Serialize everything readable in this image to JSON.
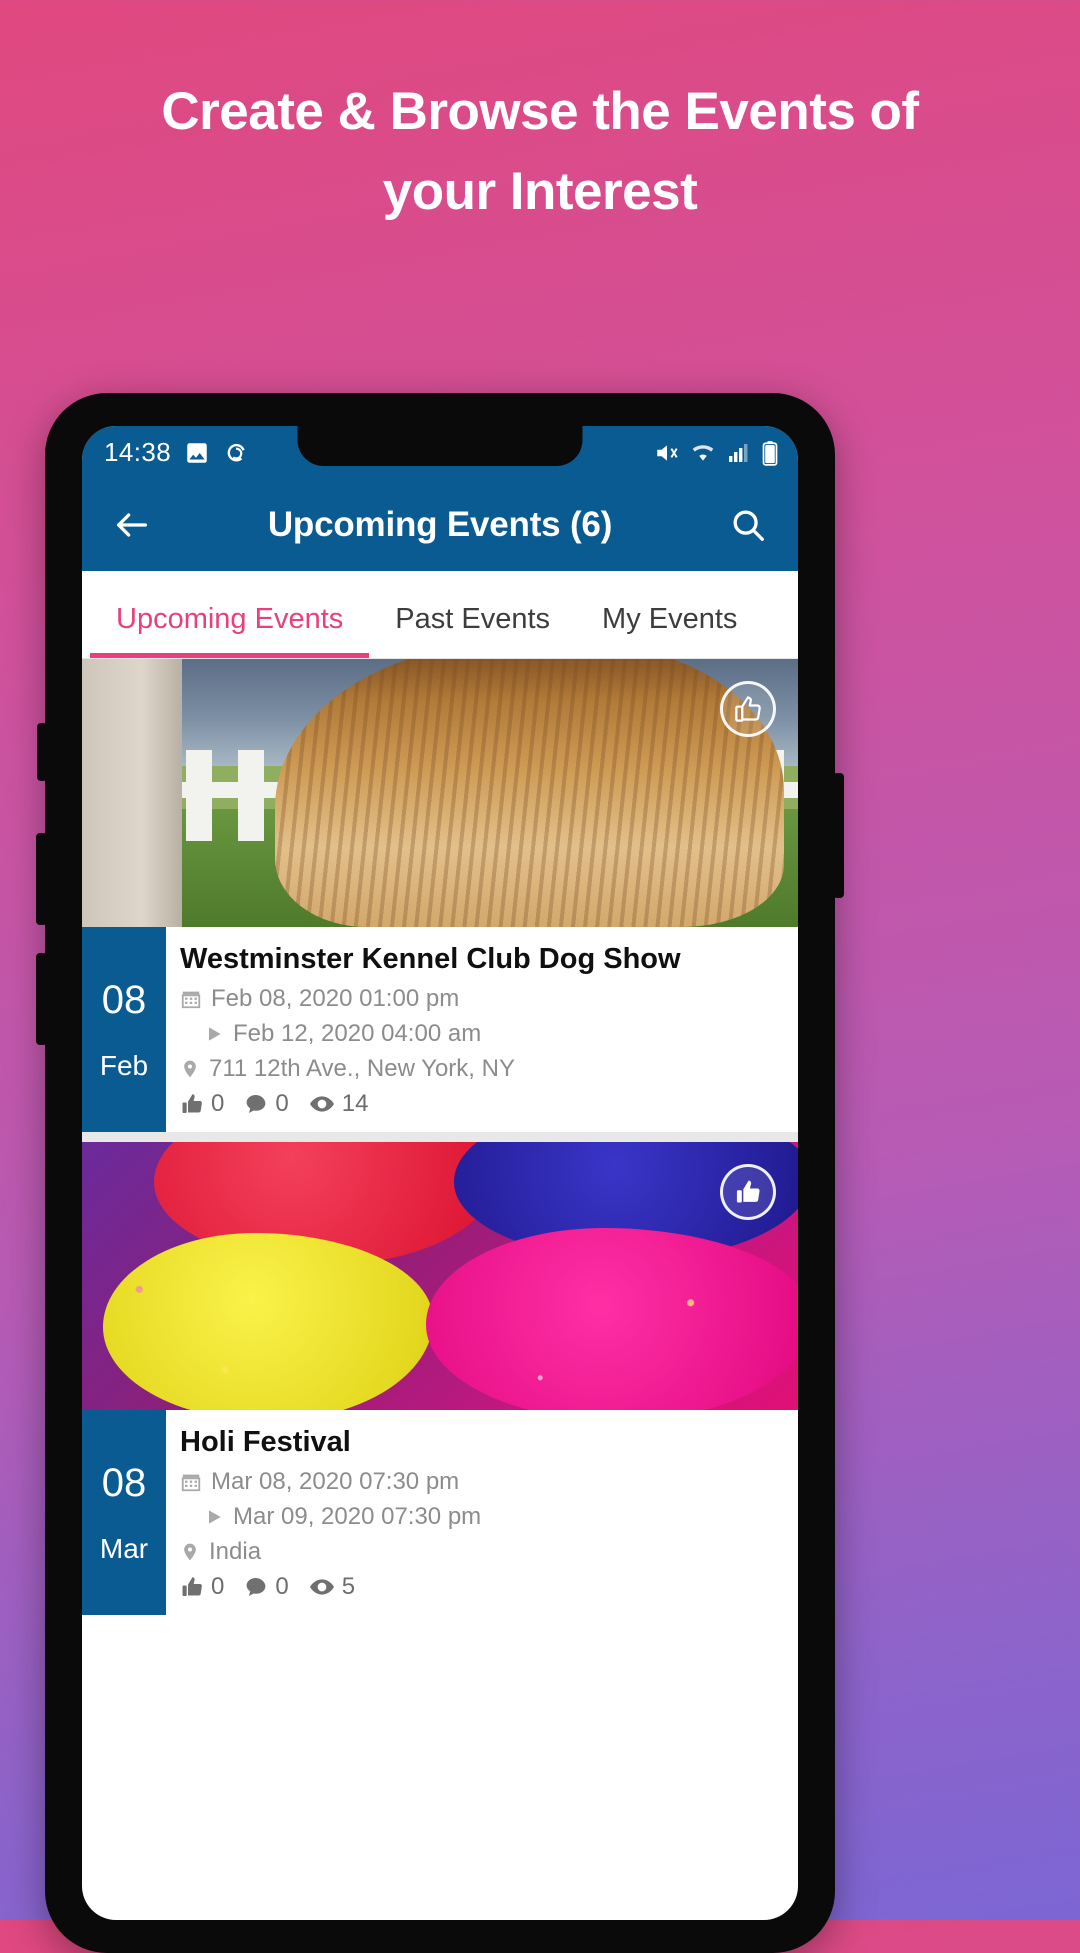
{
  "promo": {
    "headline": "Create & Browse the Events of your Interest"
  },
  "status_bar": {
    "time": "14:38",
    "left_icons": [
      "image-icon",
      "app-spiral-icon"
    ],
    "right_icons": [
      "mute-icon",
      "wifi-icon",
      "signal-icon",
      "battery-icon"
    ]
  },
  "app_bar": {
    "back_icon": "back-arrow-icon",
    "title": "Upcoming Events (6)",
    "search_icon": "search-icon"
  },
  "tabs": [
    {
      "label": "Upcoming Events",
      "active": true
    },
    {
      "label": "Past Events",
      "active": false
    },
    {
      "label": "My Events",
      "active": false
    }
  ],
  "events": [
    {
      "image": "dog-show-photo",
      "like_icon": "thumbs-up-icon",
      "date_day": "08",
      "date_month": "Feb",
      "title": "Westminster Kennel Club Dog Show",
      "start": "Feb 08, 2020 01:00 pm",
      "end": "Feb 12, 2020 04:00 am",
      "location": "711 12th Ave., New York, NY",
      "likes": "0",
      "comments": "0",
      "views": "14"
    },
    {
      "image": "holi-colors-photo",
      "like_icon": "thumbs-up-icon",
      "date_day": "08",
      "date_month": "Mar",
      "title": "Holi Festival",
      "start": "Mar 08, 2020 07:30 pm",
      "end": "Mar 09, 2020 07:30 pm",
      "location": "India",
      "likes": "0",
      "comments": "0",
      "views": "5"
    }
  ],
  "colors": {
    "brand_blue": "#0a5b92",
    "accent_pink": "#e8407f",
    "bg_gradient_start": "#e0487f",
    "bg_gradient_end": "#7c66d4"
  }
}
